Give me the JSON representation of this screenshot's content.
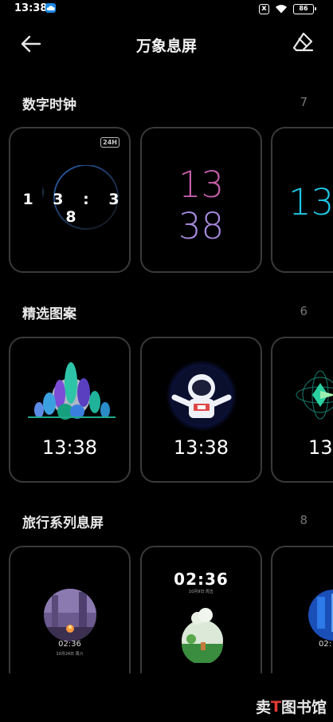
{
  "status": {
    "time": "13:38",
    "battery": "86",
    "sim": "x"
  },
  "header": {
    "title": "万象息屏"
  },
  "sections": [
    {
      "title": "数字时钟",
      "count": "7",
      "cards": [
        {
          "badge": "24H",
          "time_digits": "1 3 : 3 8"
        },
        {
          "hour": "13",
          "minute": "38"
        },
        {
          "time": "13:"
        }
      ]
    },
    {
      "title": "精选图案",
      "count": "6",
      "cards": [
        {
          "time": "13:38"
        },
        {
          "time": "13:38"
        },
        {
          "time": "13:"
        }
      ]
    },
    {
      "title": "旅行系列息屏",
      "count": "8",
      "cards": [
        {
          "time": "02:36",
          "date": "10月24日 周六"
        },
        {
          "time": "02:36",
          "date": "10月9日 周五"
        },
        {
          "time": "02:"
        }
      ]
    }
  ],
  "watermark": {
    "brand_red": "T",
    "brand_white": "图书馆",
    "brand_prefix": "卖"
  },
  "colors": {
    "background": "#000000",
    "card_border": "#3a3a3a",
    "cyan": "#1ec8e8",
    "pink": "#c45ea9",
    "lavender": "#a88ae0"
  }
}
